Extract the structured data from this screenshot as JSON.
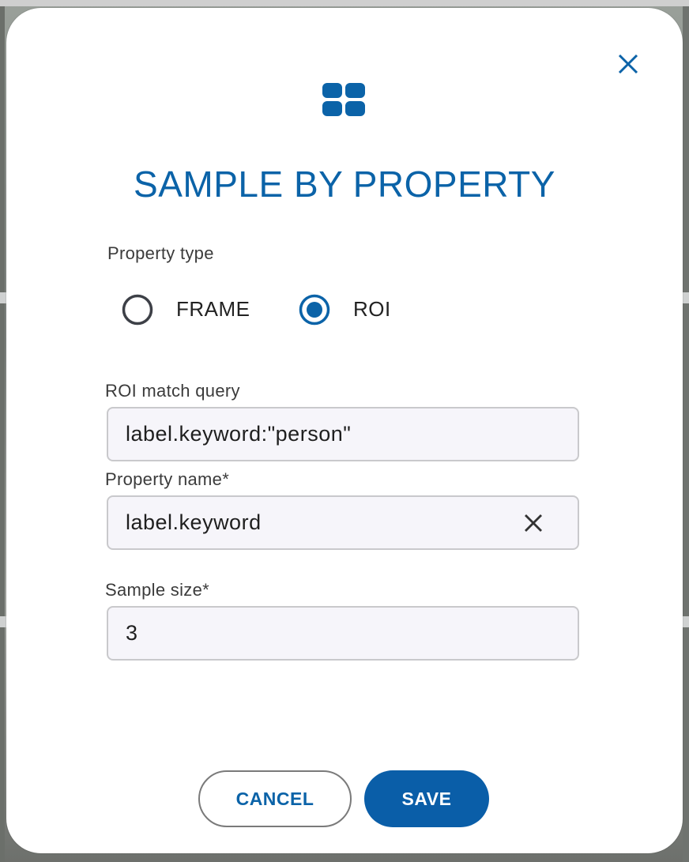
{
  "dialog": {
    "title": "SAMPLE BY PROPERTY",
    "header_icon": "grid-icon",
    "close_icon": "close-icon"
  },
  "property_type": {
    "label": "Property type",
    "options": [
      {
        "label": "FRAME",
        "selected": false
      },
      {
        "label": "ROI",
        "selected": true
      }
    ]
  },
  "roi_match_query": {
    "label": "ROI match query",
    "value": "label.keyword:\"person\""
  },
  "property_name": {
    "label": "Property name*",
    "value": "label.keyword",
    "clear_icon": "clear-icon"
  },
  "sample_size": {
    "label": "Sample size*",
    "value": "3"
  },
  "actions": {
    "cancel_label": "CANCEL",
    "save_label": "SAVE"
  },
  "colors": {
    "accent": "#0b63a8",
    "button_primary": "#0a5ea8",
    "field_bg": "#f6f5fa",
    "field_border": "#c9c9cc"
  }
}
